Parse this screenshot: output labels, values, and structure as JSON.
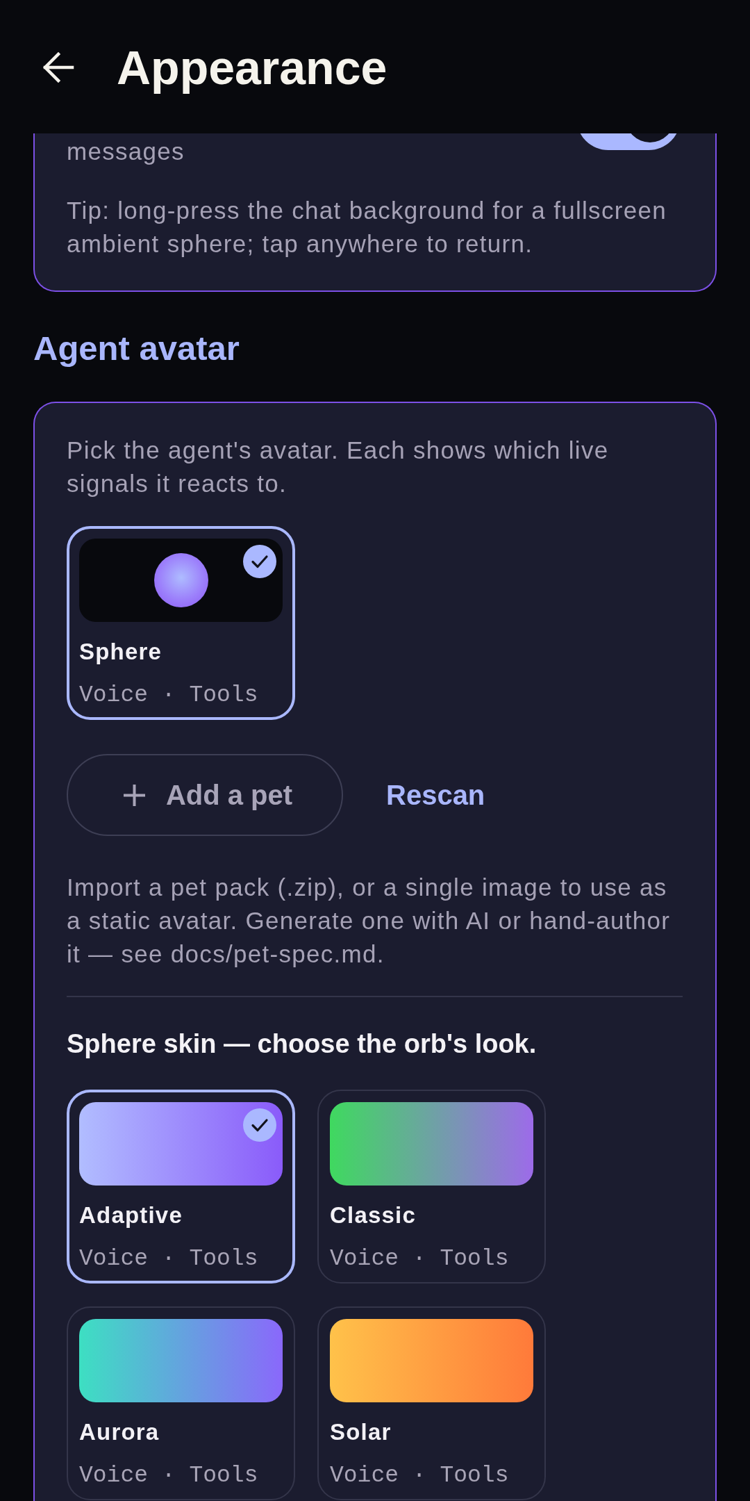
{
  "app_bar": {
    "title": "Appearance"
  },
  "top_card": {
    "label": "messages",
    "toggle": {
      "on": true
    },
    "tip": "Tip: long-press the chat background for a fullscreen ambient sphere; tap anywhere to return."
  },
  "agent_avatar": {
    "heading": "Agent avatar",
    "description": "Pick the agent's avatar. Each shows which live signals it reacts to.",
    "avatars": [
      {
        "kind": "sphere",
        "name": "Sphere",
        "signals": "Voice · Tools",
        "selected": true
      }
    ],
    "add_button": {
      "label": "Add a pet"
    },
    "rescan_button": {
      "label": "Rescan"
    },
    "import_note": "Import a pet pack (.zip), or a single image to use as a static avatar. Generate one with AI or hand-author it — see docs/pet-spec.md.",
    "skin_heading": "Sphere skin — choose the orb's look.",
    "skins": [
      {
        "name": "Adaptive",
        "signals": "Voice · Tools",
        "selected": true,
        "gradient": [
          {
            "color": "#b1bdff"
          },
          {
            "color": "#8a5bfa"
          }
        ]
      },
      {
        "name": "Classic",
        "signals": "Voice · Tools",
        "selected": false,
        "gradient": [
          {
            "color": "#3fd95f"
          },
          {
            "color": "#9d6be9"
          }
        ]
      },
      {
        "name": "Aurora",
        "signals": "Voice · Tools",
        "selected": false,
        "gradient": [
          {
            "color": "#3ddfc2"
          },
          {
            "color": "#8a68fb"
          }
        ]
      },
      {
        "name": "Solar",
        "signals": "Voice · Tools",
        "selected": false,
        "gradient": [
          {
            "color": "#ffc24a"
          },
          {
            "color": "#ff7a3a"
          }
        ]
      }
    ]
  }
}
